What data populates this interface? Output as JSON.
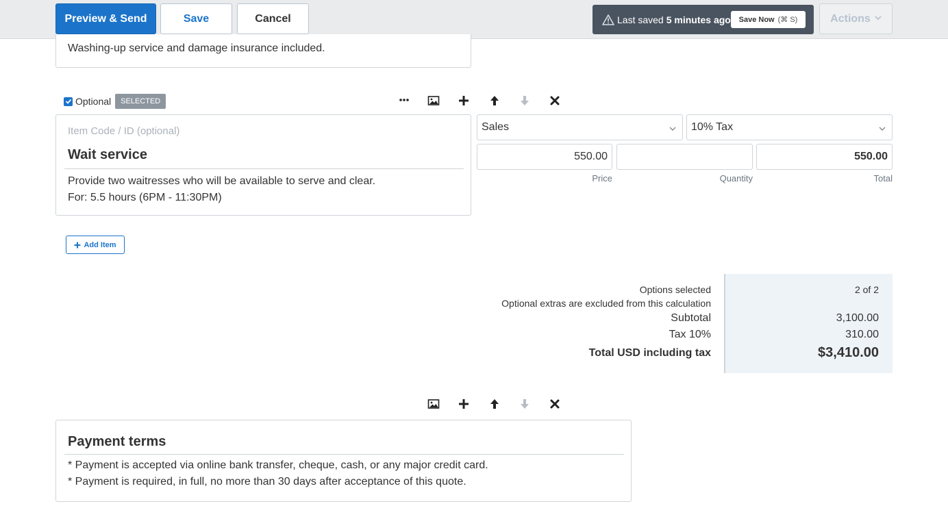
{
  "toolbar": {
    "preview_send_label": "Preview & Send",
    "save_label": "Save",
    "cancel_label": "Cancel",
    "last_saved_prefix": "Last saved",
    "last_saved_time": "5 minutes ago",
    "save_now_label": "Save Now",
    "save_now_shortcut": "(⌘ S)",
    "actions_label": "Actions"
  },
  "prev_item": {
    "description_tail": "Washing-up service and damage insurance included."
  },
  "item": {
    "optional_label": "Optional",
    "optional_checked": true,
    "selected_badge": "SELECTED",
    "code_placeholder": "Item Code / ID (optional)",
    "title": "Wait service",
    "description_lines": [
      "Provide two waitresses who will be available to serve and clear.",
      "For: 5.5 hours (6PM - 11:30PM)"
    ],
    "account": "Sales",
    "tax": "10% Tax",
    "price": "550.00",
    "quantity": "",
    "total": "550.00",
    "price_label": "Price",
    "quantity_label": "Quantity",
    "total_label": "Total"
  },
  "add_item_label": "Add Item",
  "totals": {
    "options_selected_label": "Options selected",
    "options_selected_value": "2 of 2",
    "optional_note": "Optional extras are excluded from this calculation",
    "subtotal_label": "Subtotal",
    "subtotal_value": "3,100.00",
    "tax_label": "Tax 10%",
    "tax_value": "310.00",
    "total_label": "Total USD including tax",
    "total_value": "$3,410.00"
  },
  "terms": {
    "title": "Payment terms",
    "lines": [
      "* Payment is accepted via online bank transfer, cheque, cash, or any major credit card.",
      "* Payment is required, in full, no more than 30 days after acceptance of this quote."
    ]
  },
  "colors": {
    "primary": "#1b74c9",
    "toolbar_bg": "#e9ebed",
    "saved_box_bg": "#4a5460",
    "totals_bg": "#eef3f7"
  }
}
